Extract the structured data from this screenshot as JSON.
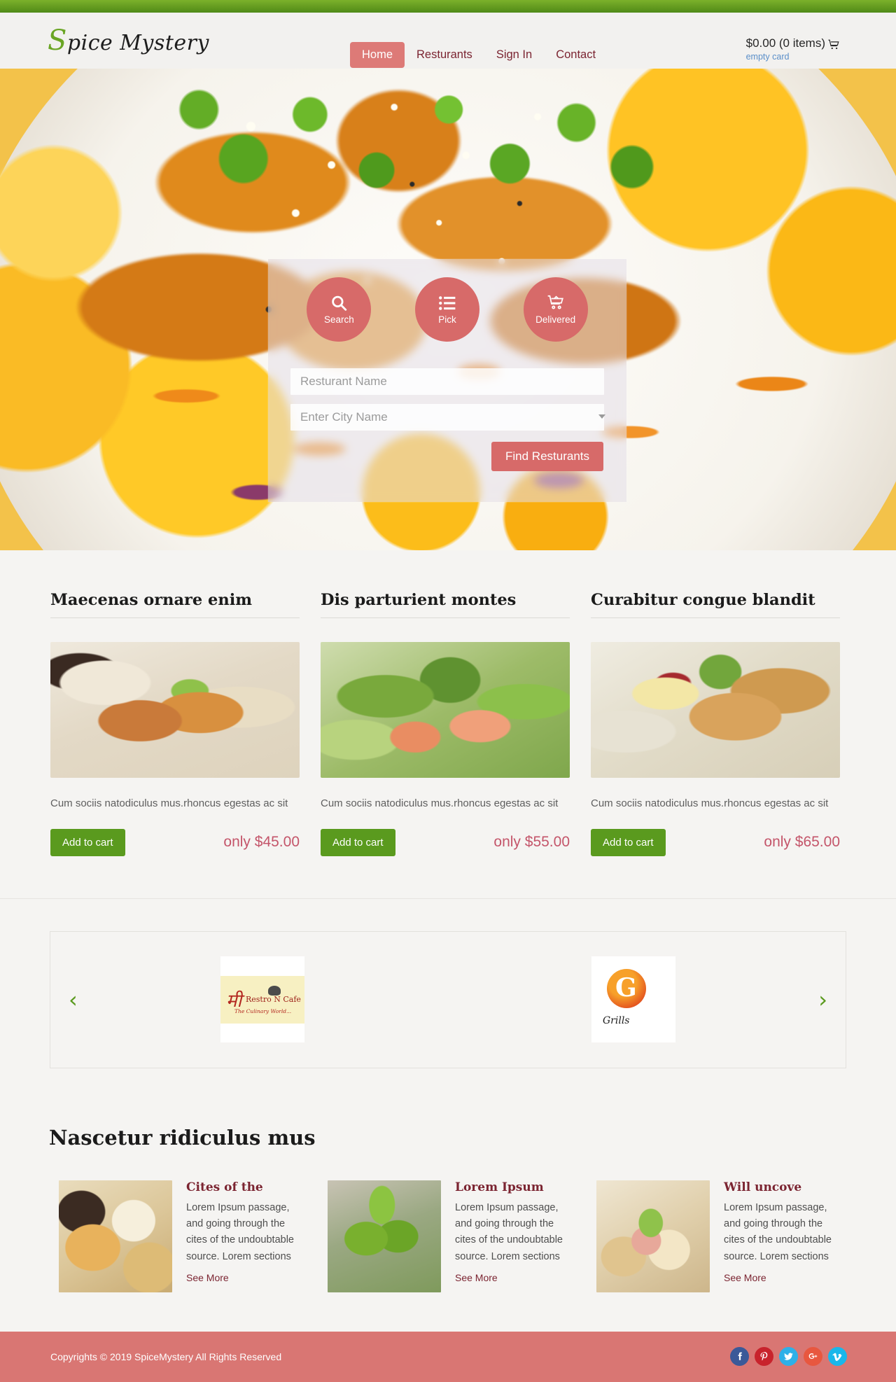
{
  "header": {
    "logo_s": "S",
    "logo_rest": "pice Mystery",
    "nav": [
      {
        "label": "Home",
        "active": true
      },
      {
        "label": "Resturants",
        "active": false
      },
      {
        "label": "Sign In",
        "active": false
      },
      {
        "label": "Contact",
        "active": false
      }
    ],
    "cart_total": "$0.00 (0 items)",
    "cart_icon": "shopping-cart-icon",
    "empty_card": "empty card"
  },
  "hero": {
    "widget": {
      "actions": [
        {
          "label": "Search",
          "icon": "search-icon"
        },
        {
          "label": "Pick",
          "icon": "list-icon"
        },
        {
          "label": "Delivered",
          "icon": "cart-icon"
        }
      ],
      "restaurant_placeholder": "Resturant Name",
      "restaurant_value": "",
      "city_placeholder": "Enter City Name",
      "city_value": "",
      "find_button": "Find Resturants"
    }
  },
  "products": [
    {
      "title": "Maecenas ornare enim",
      "desc": "Cum sociis natodiculus mus.rhoncus egestas ac sit",
      "button": "Add to cart",
      "price": "only $45.00"
    },
    {
      "title": "Dis parturient montes",
      "desc": "Cum sociis natodiculus mus.rhoncus egestas ac sit",
      "button": "Add to cart",
      "price": "only $55.00"
    },
    {
      "title": "Curabitur congue blandit",
      "desc": "Cum sociis natodiculus mus.rhoncus egestas ac sit",
      "button": "Add to cart",
      "price": "only $65.00"
    }
  ],
  "carousel": {
    "prev": "‹",
    "next": "›",
    "items": [
      {
        "name": "Restro N Cafe",
        "brand": "Restro N Cafe",
        "tagline": "The Culinary World...",
        "mark": "मी"
      },
      {
        "name": "Grills",
        "brand": "G",
        "tagline": "Grills"
      }
    ]
  },
  "news": {
    "section_title": "Nascetur ridiculus mus",
    "items": [
      {
        "heading": "Cites of the",
        "text": "Lorem Ipsum passage, and going through the cites of the undoubtable source. Lorem sections",
        "more": "See More"
      },
      {
        "heading": "Lorem Ipsum",
        "text": "Lorem Ipsum passage, and going through the cites of the undoubtable source. Lorem sections",
        "more": "See More"
      },
      {
        "heading": "Will uncove",
        "text": "Lorem Ipsum passage, and going through the cites of the undoubtable source. Lorem sections",
        "more": "See More"
      }
    ]
  },
  "footer": {
    "copyright": "Copyrights © 2019 SpiceMystery All Rights Reserved",
    "socials": [
      {
        "name": "facebook-icon",
        "glyph": "f"
      },
      {
        "name": "pinterest-icon",
        "glyph": "P"
      },
      {
        "name": "twitter-icon",
        "glyph": "ᴠ"
      },
      {
        "name": "googleplus-icon",
        "glyph": "g"
      },
      {
        "name": "vimeo-icon",
        "glyph": "v"
      }
    ]
  },
  "colors": {
    "brand_green": "#5a9a1e",
    "accent_red": "#d76a69",
    "maroon": "#7b2431",
    "price": "#c4556a",
    "footer_bg": "#d97673",
    "link_blue": "#5b8fc9"
  }
}
